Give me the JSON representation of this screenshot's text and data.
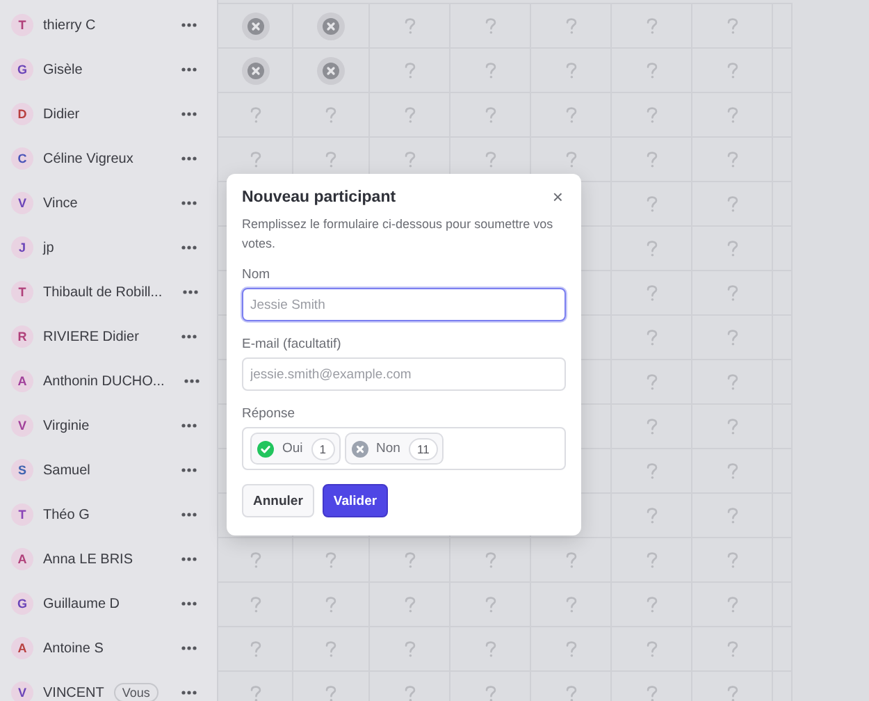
{
  "participants": [
    {
      "initial": "T",
      "name": "thierry C",
      "color": "#b0407a",
      "votes": [
        {
          "kind": "no"
        },
        {
          "kind": "no"
        },
        {
          "kind": "unknown"
        },
        {
          "kind": "unknown"
        },
        {
          "kind": "unknown"
        },
        {
          "kind": "unknown"
        },
        {
          "kind": "unknown"
        }
      ]
    },
    {
      "initial": "G",
      "name": "Gisèle",
      "color": "#6b45b8",
      "votes": [
        {
          "kind": "no"
        },
        {
          "kind": "no"
        },
        {
          "kind": "unknown"
        },
        {
          "kind": "unknown"
        },
        {
          "kind": "unknown"
        },
        {
          "kind": "unknown"
        },
        {
          "kind": "unknown"
        }
      ]
    },
    {
      "initial": "D",
      "name": "Didier",
      "color": "#b84040",
      "votes": [
        {
          "kind": "unknown"
        },
        {
          "kind": "unknown"
        },
        {
          "kind": "unknown"
        },
        {
          "kind": "unknown"
        },
        {
          "kind": "unknown"
        },
        {
          "kind": "unknown"
        },
        {
          "kind": "unknown"
        }
      ]
    },
    {
      "initial": "C",
      "name": "Céline Vigreux",
      "color": "#4a55b8",
      "votes": [
        {
          "kind": "unknown"
        },
        {
          "kind": "unknown"
        },
        {
          "kind": "unknown"
        },
        {
          "kind": "unknown"
        },
        {
          "kind": "unknown"
        },
        {
          "kind": "unknown"
        },
        {
          "kind": "unknown"
        }
      ]
    },
    {
      "initial": "V",
      "name": "Vince",
      "color": "#6b45b8",
      "votes": [
        {
          "kind": "unknown"
        },
        {
          "kind": "unknown"
        }
      ]
    },
    {
      "initial": "J",
      "name": "jp",
      "color": "#6b45b8",
      "votes": [
        {
          "kind": "unknown"
        },
        {
          "kind": "unknown"
        }
      ]
    },
    {
      "initial": "T",
      "name": "Thibault de Robill...",
      "color": "#b0407a",
      "votes": [
        {
          "kind": "unknown"
        },
        {
          "kind": "unknown"
        }
      ]
    },
    {
      "initial": "R",
      "name": "RIVIERE Didier",
      "color": "#b0407a",
      "votes": [
        {
          "kind": "unknown"
        },
        {
          "kind": "unknown"
        }
      ]
    },
    {
      "initial": "A",
      "name": "Anthonin DUCHO...",
      "color": "#a0409a",
      "votes": [
        {
          "kind": "unknown"
        },
        {
          "kind": "unknown"
        }
      ]
    },
    {
      "initial": "V",
      "name": "Virginie",
      "color": "#a0409a",
      "votes": [
        {
          "kind": "unknown"
        },
        {
          "kind": "unknown"
        }
      ]
    },
    {
      "initial": "S",
      "name": "Samuel",
      "color": "#4064b0",
      "votes": [
        {
          "kind": "unknown"
        },
        {
          "kind": "unknown"
        }
      ]
    },
    {
      "initial": "T",
      "name": "Théo G",
      "color": "#8a45b8",
      "votes": [
        {
          "kind": "unknown"
        },
        {
          "kind": "unknown"
        }
      ]
    },
    {
      "initial": "A",
      "name": "Anna LE BRIS",
      "color": "#b0407a",
      "votes": [
        {
          "kind": "unknown"
        },
        {
          "kind": "unknown"
        },
        {
          "kind": "unknown"
        },
        {
          "kind": "unknown"
        },
        {
          "kind": "unknown"
        },
        {
          "kind": "unknown"
        },
        {
          "kind": "unknown"
        }
      ]
    },
    {
      "initial": "G",
      "name": "Guillaume D",
      "color": "#6b45b8",
      "votes": [
        {
          "kind": "unknown"
        },
        {
          "kind": "unknown"
        },
        {
          "kind": "unknown"
        },
        {
          "kind": "unknown"
        },
        {
          "kind": "unknown"
        },
        {
          "kind": "unknown"
        },
        {
          "kind": "unknown"
        }
      ]
    },
    {
      "initial": "A",
      "name": "Antoine S",
      "color": "#b84040",
      "votes": [
        {
          "kind": "unknown"
        },
        {
          "kind": "unknown"
        },
        {
          "kind": "unknown"
        },
        {
          "kind": "unknown"
        },
        {
          "kind": "unknown"
        },
        {
          "kind": "unknown"
        },
        {
          "kind": "unknown"
        }
      ]
    },
    {
      "initial": "V",
      "name": "VINCENT",
      "badge": "Vous",
      "color": "#6b45b8",
      "votes": [
        {
          "kind": "unknown"
        },
        {
          "kind": "unknown"
        },
        {
          "kind": "unknown"
        },
        {
          "kind": "unknown"
        },
        {
          "kind": "unknown"
        },
        {
          "kind": "unknown"
        },
        {
          "kind": "unknown"
        }
      ]
    }
  ],
  "dialog": {
    "title": "Nouveau participant",
    "close": "×",
    "description": "Remplissez le formulaire ci-dessous pour soumettre vos votes.",
    "name_field": {
      "label": "Nom",
      "placeholder": "Jessie Smith",
      "focused": true
    },
    "email_field": {
      "label": "E-mail (facultatif)",
      "placeholder": "jessie.smith@example.com",
      "focused": false
    },
    "response": {
      "label": "Réponse",
      "options": [
        {
          "kind": "yes",
          "label": "Oui",
          "count": "1"
        },
        {
          "kind": "no",
          "label": "Non",
          "count": "11"
        }
      ]
    },
    "buttons": [
      {
        "kind": "secondary",
        "label": "Annuler"
      },
      {
        "kind": "primary",
        "label": "Valider"
      }
    ]
  }
}
